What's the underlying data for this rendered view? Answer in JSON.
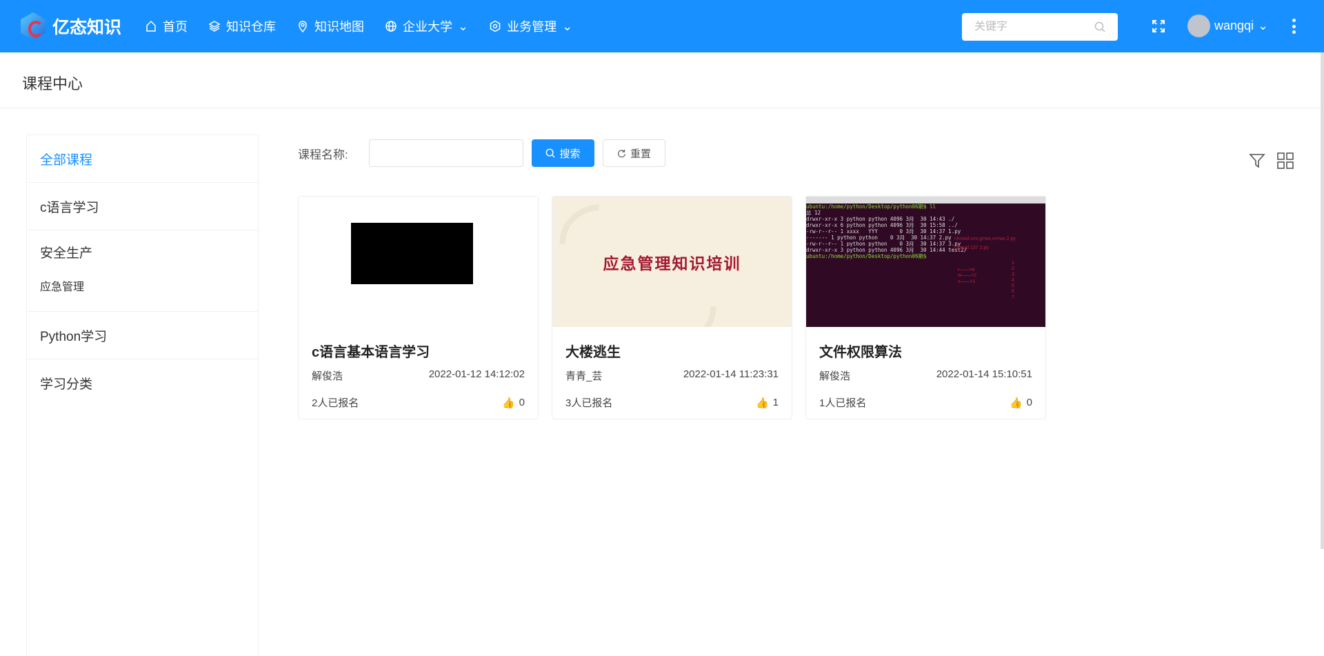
{
  "header": {
    "logo": "亿态知识",
    "nav": [
      {
        "label": "首页",
        "icon": "home-icon"
      },
      {
        "label": "知识仓库",
        "icon": "layers-icon"
      },
      {
        "label": "知识地图",
        "icon": "location-icon"
      },
      {
        "label": "企业大学",
        "icon": "globe-icon",
        "dropdown": true
      },
      {
        "label": "业务管理",
        "icon": "gear-icon",
        "dropdown": true
      }
    ],
    "search_placeholder": "关键字",
    "user": "wangqi"
  },
  "page": {
    "title": "课程中心"
  },
  "sidebar": {
    "items": [
      {
        "label": "全部课程",
        "active": true
      },
      {
        "label": "c语言学习"
      },
      {
        "label": "安全生产"
      },
      {
        "label": "应急管理"
      },
      {
        "label": "Python学习"
      },
      {
        "label": "学习分类"
      }
    ]
  },
  "filter": {
    "label": "课程名称:",
    "value": "",
    "search": "搜索",
    "reset": "重置"
  },
  "courses": [
    {
      "title": "c语言基本语言学习",
      "author": "解俊浩",
      "date": "2022-01-12 14:12:02",
      "enrolled": "2人已报名",
      "likes": "0"
    },
    {
      "title": "大楼逃生",
      "author": "青青_芸",
      "date": "2022-01-14 11:23:31",
      "enrolled": "3人已报名",
      "likes": "1",
      "cover_text": "应急管理知识培训"
    },
    {
      "title": "文件权限算法",
      "author": "解俊浩",
      "date": "2022-01-14 15:10:51",
      "enrolled": "1人已报名",
      "likes": "0",
      "terminal": [
        "ubuntu:/home/python/Desktop/python06期$ ll",
        "总 12",
        "drwxr-xr-x 3 python python 4096 3月  30 14:43 ./",
        "drwxr-xr-x 6 python python 4096 3月  30 15:58 ../",
        "-rw-r--r-- 1 xxxx   YYY       0 3月  30 14:37 1.py",
        "------- 1 python python    0 3月  30 14:37 2.py",
        "-rw-r--r-- 1 python python    0 3月  30 14:37 3.py",
        "drwxr-xr-x 3 python python 4096 3月  30 14:44 test2/",
        "ubuntu:/home/python/Desktop/python06期$"
      ],
      "notes": [
        "chmod u=x,g=wx,o=rwx 2.py",
        "chmod 137 2.py"
      ],
      "arrows": "r——>4\nw——>2\nx——>1",
      "digits": "1\n2\n3\n4\n5\n6\n7"
    }
  ]
}
